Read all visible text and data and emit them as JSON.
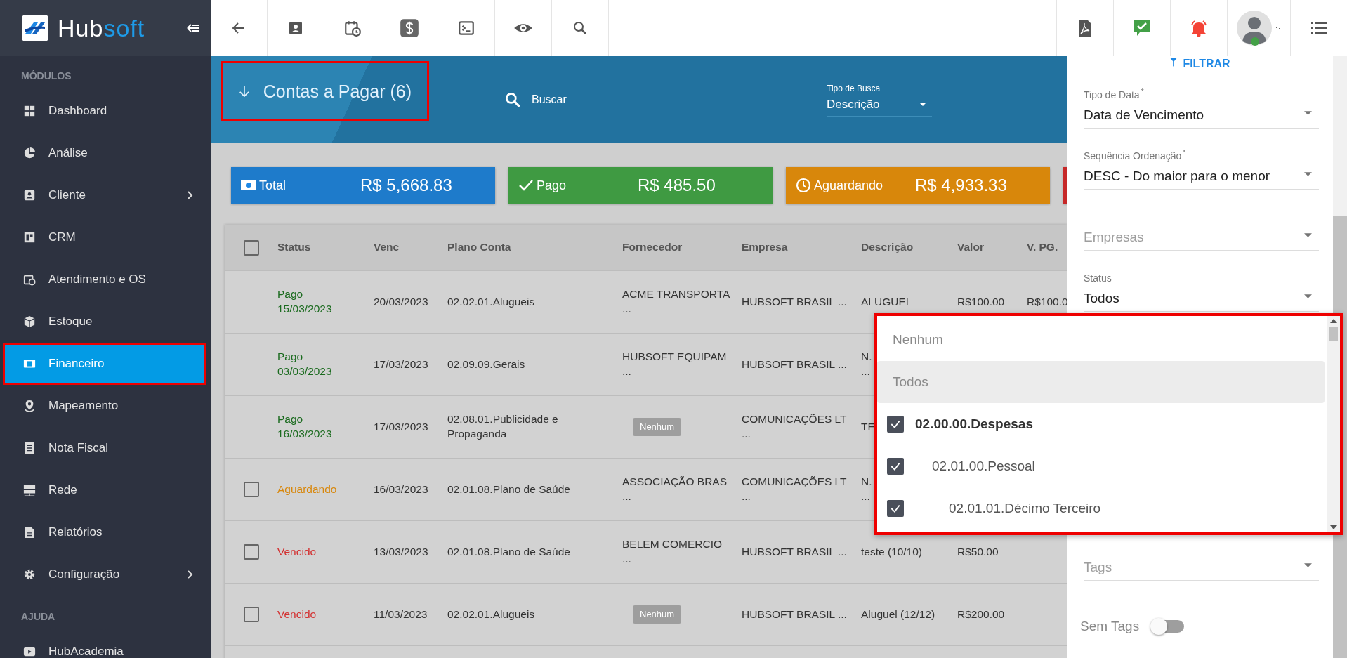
{
  "brand": {
    "name_a": "Hub",
    "name_b": "soft"
  },
  "sidebar": {
    "sections": [
      {
        "title": "MÓDULOS",
        "items": [
          {
            "label": "Dashboard",
            "expandable": false,
            "selected": false
          },
          {
            "label": "Análise",
            "expandable": false,
            "selected": false
          },
          {
            "label": "Cliente",
            "expandable": true,
            "selected": false
          },
          {
            "label": "CRM",
            "expandable": false,
            "selected": false
          },
          {
            "label": "Atendimento e OS",
            "expandable": false,
            "selected": false
          },
          {
            "label": "Estoque",
            "expandable": false,
            "selected": false
          },
          {
            "label": "Financeiro",
            "expandable": false,
            "selected": true
          },
          {
            "label": "Mapeamento",
            "expandable": false,
            "selected": false
          },
          {
            "label": "Nota Fiscal",
            "expandable": false,
            "selected": false
          },
          {
            "label": "Rede",
            "expandable": false,
            "selected": false
          },
          {
            "label": "Relatórios",
            "expandable": false,
            "selected": false
          },
          {
            "label": "Configuração",
            "expandable": true,
            "selected": false
          }
        ]
      },
      {
        "title": "AJUDA",
        "items": [
          {
            "label": "HubAcademia",
            "expandable": false,
            "selected": false
          }
        ]
      }
    ]
  },
  "header": {
    "title": "Contas a Pagar (6)",
    "search_placeholder": "Buscar",
    "search_type": {
      "label": "Tipo de Busca",
      "value": "Descrição"
    }
  },
  "summary_cards": [
    {
      "kind": "total",
      "label": "Total",
      "value": "R$ 5,668.83"
    },
    {
      "kind": "paid",
      "label": "Pago",
      "value": "R$ 485.50"
    },
    {
      "kind": "waiting",
      "label": "Aguardando",
      "value": "R$ 4,933.33"
    },
    {
      "kind": "overdue"
    }
  ],
  "table": {
    "columns": [
      "Status",
      "Venc",
      "Plano Conta",
      "Fornecedor",
      "Empresa",
      "Descrição",
      "Valor",
      "V. PG."
    ],
    "header_checked": false,
    "rows": [
      {
        "status": {
          "kind": "paid",
          "text": "Pago\n15/03/2023"
        },
        "venc": "20/03/2023",
        "plano": "02.02.01.Alugueis",
        "fornecedor": {
          "kind": "text",
          "text": "ACME TRANSPORTA\n..."
        },
        "empresa": "HUBSOFT BRASIL ...",
        "descricao": "ALUGUEL",
        "valor": "R$100.00",
        "vpg": "R$100.0"
      },
      {
        "status": {
          "kind": "paid",
          "text": "Pago\n03/03/2023"
        },
        "venc": "17/03/2023",
        "plano": "02.09.09.Gerais",
        "fornecedor": {
          "kind": "text",
          "text": "HUBSOFT EQUIPAM\n..."
        },
        "empresa": "HUBSOFT BRASIL ...",
        "descricao": "N.\n...",
        "valor": "",
        "vpg": ""
      },
      {
        "status": {
          "kind": "paid",
          "text": "Pago\n16/03/2023"
        },
        "venc": "17/03/2023",
        "plano": "02.08.01.Publicidade e\nPropaganda",
        "fornecedor": {
          "kind": "tag",
          "text": "Nenhum"
        },
        "empresa": "COMUNICAÇÕES LT\n...",
        "descricao": "TE",
        "valor": "",
        "vpg": ""
      },
      {
        "checked": false,
        "status": {
          "kind": "waiting",
          "text": "Aguardando"
        },
        "venc": "16/03/2023",
        "plano": "02.01.08.Plano de Saúde",
        "fornecedor": {
          "kind": "text",
          "text": "ASSOCIAÇÃO BRAS\n..."
        },
        "empresa": "COMUNICAÇÕES LT\n...",
        "descricao": "N.\n...",
        "valor": "",
        "vpg": ""
      },
      {
        "checked": false,
        "status": {
          "kind": "overdue",
          "text": "Vencido"
        },
        "venc": "13/03/2023",
        "plano": "02.01.08.Plano de Saúde",
        "fornecedor": {
          "kind": "text",
          "text": "BELEM COMERCIO\n..."
        },
        "empresa": "HUBSOFT BRASIL ...",
        "descricao": "teste (10/10)",
        "valor": "R$50.00",
        "vpg": ""
      },
      {
        "checked": false,
        "status": {
          "kind": "overdue",
          "text": "Vencido"
        },
        "venc": "11/03/2023",
        "plano": "02.02.01.Alugueis",
        "fornecedor": {
          "kind": "tag",
          "text": "Nenhum"
        },
        "empresa": "HUBSOFT BRASIL ...",
        "descricao": "Aluguel (12/12)",
        "valor": "R$200.00",
        "vpg": ""
      }
    ]
  },
  "filter_panel": {
    "button": "FILTRAR",
    "fields": [
      {
        "label": "Tipo de Data",
        "required_mark": "*",
        "value": "Data de Vencimento"
      },
      {
        "label": "Sequência Ordenação",
        "required_mark": "*",
        "value": "DESC - Do maior para o menor"
      },
      {
        "placeholder": "Empresas"
      },
      {
        "label": "Status",
        "value": "Todos"
      }
    ],
    "tags": {
      "placeholder": "Tags"
    },
    "sem_tags": {
      "label": "Sem Tags",
      "on": false
    }
  },
  "dropdown": {
    "options": [
      {
        "label": "Nenhum",
        "highlighted": false
      },
      {
        "label": "Todos",
        "highlighted": true
      }
    ],
    "tree": [
      {
        "label": "02.00.00.Despesas",
        "checked": true,
        "children": [
          {
            "label": "02.01.00.Pessoal",
            "checked": true,
            "children": [
              {
                "label": "02.01.01.Décimo Terceiro",
                "checked": true
              }
            ]
          }
        ]
      }
    ]
  }
}
